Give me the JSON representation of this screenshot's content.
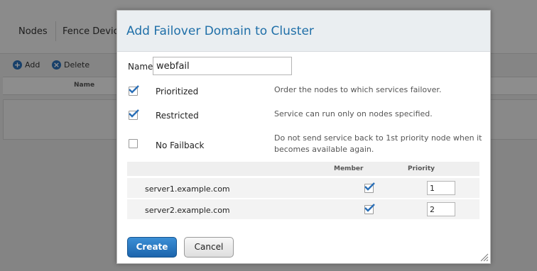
{
  "background": {
    "tabs": [
      "Nodes",
      "Fence Devic"
    ],
    "toolbar": {
      "add_label": "Add",
      "delete_label": "Delete"
    },
    "table_header": "Name"
  },
  "dialog": {
    "title": "Add Failover Domain to Cluster",
    "name_label": "Name",
    "name_value": "webfail",
    "options": [
      {
        "label": "Prioritized",
        "checked": true,
        "description": "Order the nodes to which services failover."
      },
      {
        "label": "Restricted",
        "checked": true,
        "description": "Service can run only on nodes specified."
      },
      {
        "label": "No Failback",
        "checked": false,
        "description_line1": "Do not send service back to 1st priority node when it",
        "description_line2": "becomes available again."
      }
    ],
    "table": {
      "columns": {
        "member": "Member",
        "priority": "Priority"
      },
      "rows": [
        {
          "name": "server1.example.com",
          "member": true,
          "priority": "1"
        },
        {
          "name": "server2.example.com",
          "member": true,
          "priority": "2"
        }
      ]
    },
    "buttons": {
      "create": "Create",
      "cancel": "Cancel"
    }
  },
  "colors": {
    "title": "#1f6fa8",
    "create_button": "#2a7ac4",
    "check": "#2a6fb7"
  }
}
